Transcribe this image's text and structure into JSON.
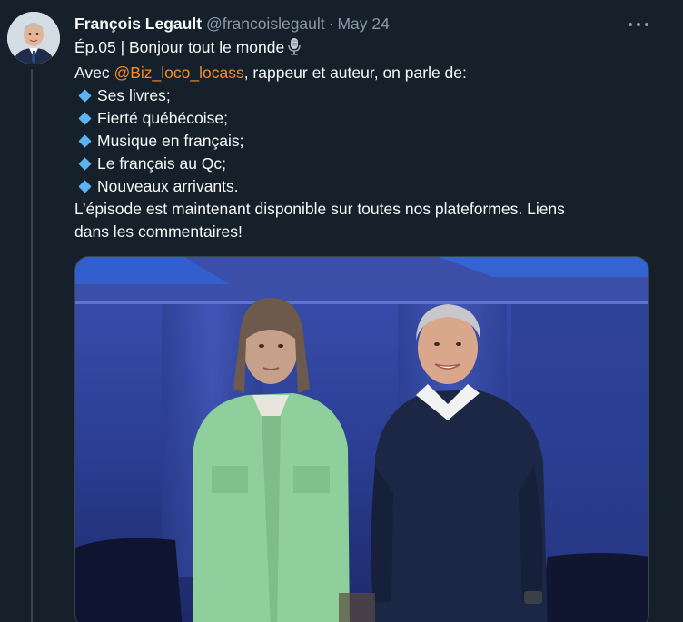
{
  "tweet": {
    "display_name": "François Legault",
    "handle": "@francoislegault",
    "separator": "·",
    "date": "May 24",
    "title_line": "Ép.05 | Bonjour tout le monde",
    "intro_prefix": "Avec ",
    "mention": "@Biz_loco_locass",
    "intro_suffix": ", rappeur et auteur, on parle de:",
    "bullets": [
      "Ses livres;",
      "Fierté québécoise;",
      "Musique en français;",
      "Le français au Qc;",
      "Nouveaux arrivants."
    ],
    "closing_line_1": "L’épisode est maintenant disponible sur toutes nos plateformes. Liens",
    "closing_line_2": "dans les commentaires!"
  },
  "icons": {
    "more": "more-horizontal-icon",
    "mic": "microphone-icon",
    "bullet": "small-blue-diamond-icon"
  },
  "colors": {
    "background": "#15202b",
    "text": "#f7f9f9",
    "secondary": "#8b98a5",
    "mention": "#f28c28",
    "bullet": "#5ab4f0",
    "thread_line": "#38444d"
  }
}
